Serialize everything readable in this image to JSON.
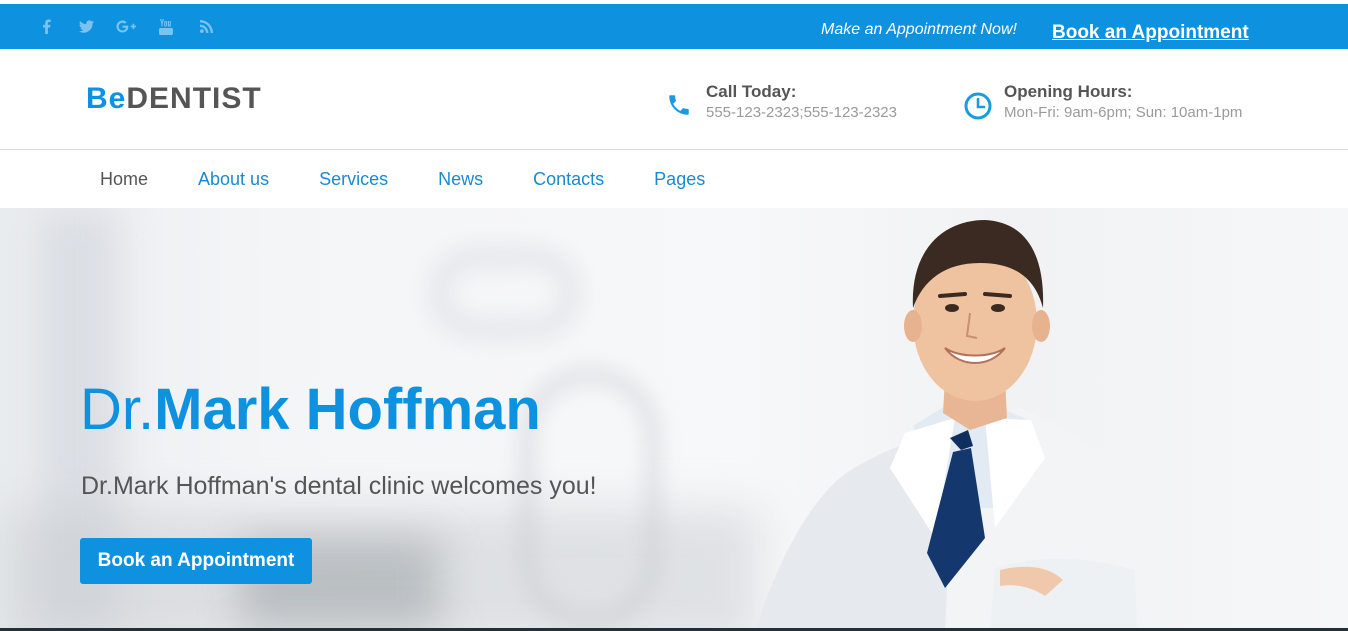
{
  "topbar": {
    "social": [
      "facebook-icon",
      "twitter-icon",
      "google-plus-icon",
      "youtube-icon",
      "rss-icon"
    ],
    "cta_text": "Make an Appointment Now!",
    "cta_link": "Book an Appointment",
    "color": "#0e92e0"
  },
  "header": {
    "logo_be": "Be",
    "logo_dentist": "DENTIST",
    "call_title": "Call Today:",
    "call_value": "555-123-2323;555-123-2323",
    "hours_title": "Opening Hours:",
    "hours_value": "Mon-Fri: 9am-6pm; Sun: 10am-1pm"
  },
  "nav": {
    "items": [
      {
        "label": "Home"
      },
      {
        "label": "About us"
      },
      {
        "label": "Services"
      },
      {
        "label": "News"
      },
      {
        "label": "Contacts"
      },
      {
        "label": "Pages"
      }
    ]
  },
  "hero": {
    "title_prefix": "Dr.",
    "title_name": "Mark Hoffman",
    "subtitle": "Dr.Mark Hoffman's dental clinic welcomes you!",
    "button": "Book an Appointment"
  },
  "colors": {
    "accent": "#0e92e0",
    "text_dark": "#555555",
    "text_muted": "#9a9a9a"
  }
}
